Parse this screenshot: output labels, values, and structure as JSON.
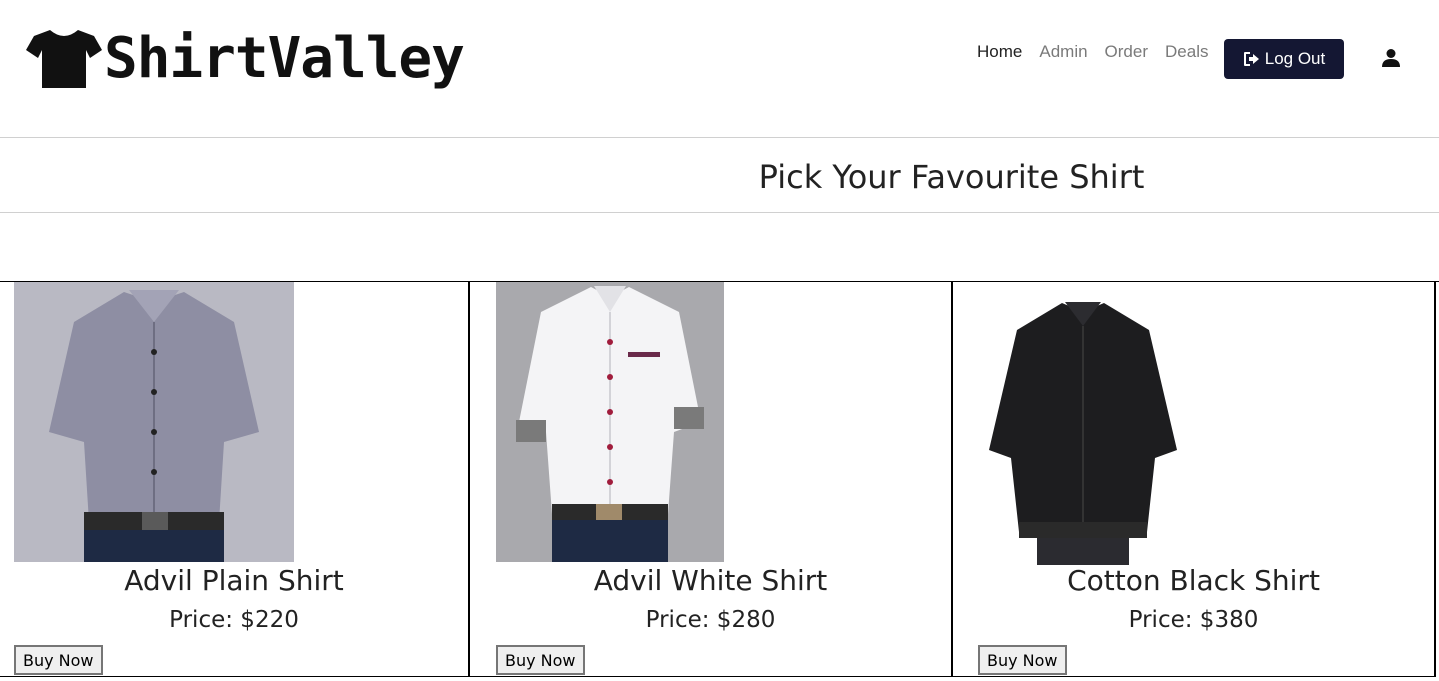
{
  "brand": {
    "name": "ShirtValley",
    "logo_icon": "tshirt-icon"
  },
  "nav": {
    "items": [
      {
        "label": "Home",
        "active": true
      },
      {
        "label": "Admin",
        "active": false
      },
      {
        "label": "Order",
        "active": false
      },
      {
        "label": "Deals",
        "active": false
      }
    ],
    "logout_label": "Log Out",
    "logout_icon": "sign-out-icon",
    "user_icon": "user-icon"
  },
  "main": {
    "title": "Pick Your Favourite Shirt"
  },
  "products": [
    {
      "name": "Advil Plain Shirt",
      "price": "Price: $220",
      "button": "Buy Now",
      "shirt_color": "#8e8ea3"
    },
    {
      "name": "Advil White Shirt",
      "price": "Price: $280",
      "button": "Buy Now",
      "shirt_color": "#f4f4f6"
    },
    {
      "name": "Cotton Black Shirt",
      "price": "Price: $380",
      "button": "Buy Now",
      "shirt_color": "#1d1d1f"
    }
  ],
  "colors": {
    "logout_bg": "#141733",
    "text": "#222222",
    "nav_muted": "#7a7a7a"
  }
}
